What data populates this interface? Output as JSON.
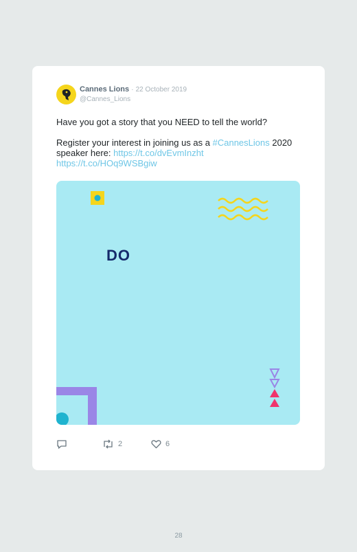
{
  "tweet": {
    "author_name": "Cannes Lions",
    "separator": "·",
    "date": "22 October 2019",
    "handle": "@Cannes_Lions",
    "line1": "Have you got a story that you NEED to tell the world?",
    "line2_prefix": "Register your interest in joining us as a ",
    "hashtag": "#CannesLions",
    "line2_mid": " 2020 speaker here: ",
    "link1": "https://t.co/dvEvmInzht",
    "link2": "https://t.co/HOq9WSBgiw",
    "media_text": "DO"
  },
  "actions": {
    "reply_icon": "reply-icon",
    "retweet_icon": "retweet-icon",
    "retweet_count": "2",
    "like_icon": "heart-icon",
    "like_count": "6"
  },
  "colors": {
    "link": "#6ec6e6",
    "avatar": "#f5d51c",
    "media_bg": "#a9eaf3",
    "do_text": "#152a6b",
    "accent_pink": "#f0346c",
    "accent_purple": "#9a86e6"
  },
  "page": {
    "number": "28"
  }
}
